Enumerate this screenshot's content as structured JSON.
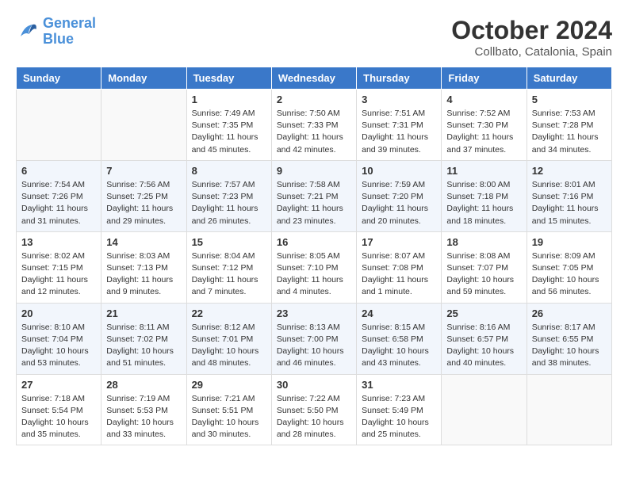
{
  "header": {
    "logo_line1": "General",
    "logo_line2": "Blue",
    "month": "October 2024",
    "location": "Collbato, Catalonia, Spain"
  },
  "columns": [
    "Sunday",
    "Monday",
    "Tuesday",
    "Wednesday",
    "Thursday",
    "Friday",
    "Saturday"
  ],
  "weeks": [
    [
      {
        "day": "",
        "info": ""
      },
      {
        "day": "",
        "info": ""
      },
      {
        "day": "1",
        "info": "Sunrise: 7:49 AM\nSunset: 7:35 PM\nDaylight: 11 hours and 45 minutes."
      },
      {
        "day": "2",
        "info": "Sunrise: 7:50 AM\nSunset: 7:33 PM\nDaylight: 11 hours and 42 minutes."
      },
      {
        "day": "3",
        "info": "Sunrise: 7:51 AM\nSunset: 7:31 PM\nDaylight: 11 hours and 39 minutes."
      },
      {
        "day": "4",
        "info": "Sunrise: 7:52 AM\nSunset: 7:30 PM\nDaylight: 11 hours and 37 minutes."
      },
      {
        "day": "5",
        "info": "Sunrise: 7:53 AM\nSunset: 7:28 PM\nDaylight: 11 hours and 34 minutes."
      }
    ],
    [
      {
        "day": "6",
        "info": "Sunrise: 7:54 AM\nSunset: 7:26 PM\nDaylight: 11 hours and 31 minutes."
      },
      {
        "day": "7",
        "info": "Sunrise: 7:56 AM\nSunset: 7:25 PM\nDaylight: 11 hours and 29 minutes."
      },
      {
        "day": "8",
        "info": "Sunrise: 7:57 AM\nSunset: 7:23 PM\nDaylight: 11 hours and 26 minutes."
      },
      {
        "day": "9",
        "info": "Sunrise: 7:58 AM\nSunset: 7:21 PM\nDaylight: 11 hours and 23 minutes."
      },
      {
        "day": "10",
        "info": "Sunrise: 7:59 AM\nSunset: 7:20 PM\nDaylight: 11 hours and 20 minutes."
      },
      {
        "day": "11",
        "info": "Sunrise: 8:00 AM\nSunset: 7:18 PM\nDaylight: 11 hours and 18 minutes."
      },
      {
        "day": "12",
        "info": "Sunrise: 8:01 AM\nSunset: 7:16 PM\nDaylight: 11 hours and 15 minutes."
      }
    ],
    [
      {
        "day": "13",
        "info": "Sunrise: 8:02 AM\nSunset: 7:15 PM\nDaylight: 11 hours and 12 minutes."
      },
      {
        "day": "14",
        "info": "Sunrise: 8:03 AM\nSunset: 7:13 PM\nDaylight: 11 hours and 9 minutes."
      },
      {
        "day": "15",
        "info": "Sunrise: 8:04 AM\nSunset: 7:12 PM\nDaylight: 11 hours and 7 minutes."
      },
      {
        "day": "16",
        "info": "Sunrise: 8:05 AM\nSunset: 7:10 PM\nDaylight: 11 hours and 4 minutes."
      },
      {
        "day": "17",
        "info": "Sunrise: 8:07 AM\nSunset: 7:08 PM\nDaylight: 11 hours and 1 minute."
      },
      {
        "day": "18",
        "info": "Sunrise: 8:08 AM\nSunset: 7:07 PM\nDaylight: 10 hours and 59 minutes."
      },
      {
        "day": "19",
        "info": "Sunrise: 8:09 AM\nSunset: 7:05 PM\nDaylight: 10 hours and 56 minutes."
      }
    ],
    [
      {
        "day": "20",
        "info": "Sunrise: 8:10 AM\nSunset: 7:04 PM\nDaylight: 10 hours and 53 minutes."
      },
      {
        "day": "21",
        "info": "Sunrise: 8:11 AM\nSunset: 7:02 PM\nDaylight: 10 hours and 51 minutes."
      },
      {
        "day": "22",
        "info": "Sunrise: 8:12 AM\nSunset: 7:01 PM\nDaylight: 10 hours and 48 minutes."
      },
      {
        "day": "23",
        "info": "Sunrise: 8:13 AM\nSunset: 7:00 PM\nDaylight: 10 hours and 46 minutes."
      },
      {
        "day": "24",
        "info": "Sunrise: 8:15 AM\nSunset: 6:58 PM\nDaylight: 10 hours and 43 minutes."
      },
      {
        "day": "25",
        "info": "Sunrise: 8:16 AM\nSunset: 6:57 PM\nDaylight: 10 hours and 40 minutes."
      },
      {
        "day": "26",
        "info": "Sunrise: 8:17 AM\nSunset: 6:55 PM\nDaylight: 10 hours and 38 minutes."
      }
    ],
    [
      {
        "day": "27",
        "info": "Sunrise: 7:18 AM\nSunset: 5:54 PM\nDaylight: 10 hours and 35 minutes."
      },
      {
        "day": "28",
        "info": "Sunrise: 7:19 AM\nSunset: 5:53 PM\nDaylight: 10 hours and 33 minutes."
      },
      {
        "day": "29",
        "info": "Sunrise: 7:21 AM\nSunset: 5:51 PM\nDaylight: 10 hours and 30 minutes."
      },
      {
        "day": "30",
        "info": "Sunrise: 7:22 AM\nSunset: 5:50 PM\nDaylight: 10 hours and 28 minutes."
      },
      {
        "day": "31",
        "info": "Sunrise: 7:23 AM\nSunset: 5:49 PM\nDaylight: 10 hours and 25 minutes."
      },
      {
        "day": "",
        "info": ""
      },
      {
        "day": "",
        "info": ""
      }
    ]
  ]
}
